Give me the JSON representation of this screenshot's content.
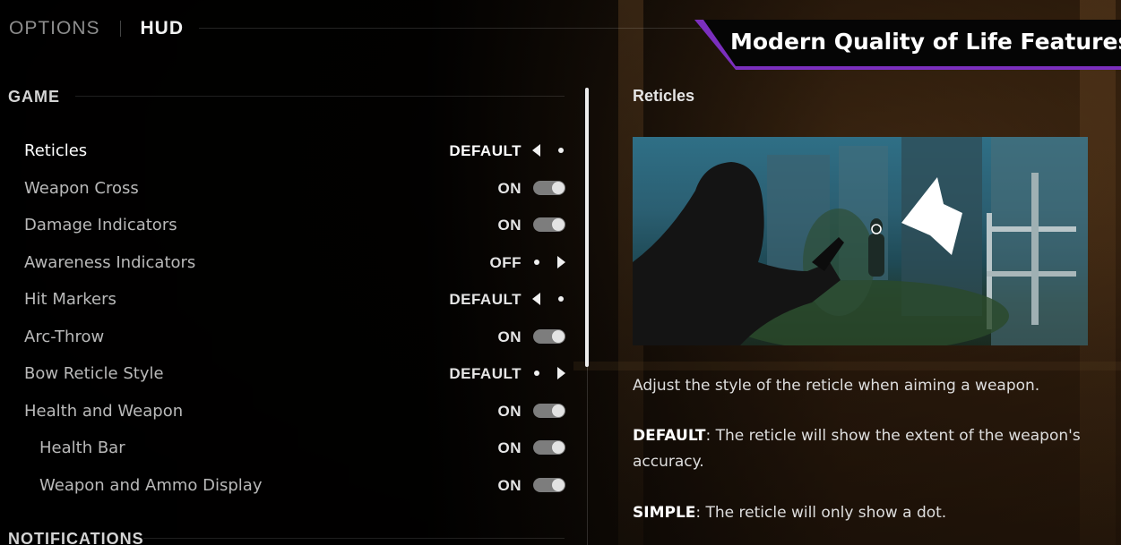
{
  "tabs": {
    "options": "OPTIONS",
    "hud": "HUD"
  },
  "banner": {
    "text": "Modern Quality of Life Features"
  },
  "sections": {
    "game": "GAME",
    "notifications": "NOTIFICATIONS"
  },
  "settings": [
    {
      "label": "Reticles",
      "value": "DEFAULT",
      "control": "option-left"
    },
    {
      "label": "Weapon Cross",
      "value": "ON",
      "control": "toggle"
    },
    {
      "label": "Damage Indicators",
      "value": "ON",
      "control": "toggle"
    },
    {
      "label": "Awareness Indicators",
      "value": "OFF",
      "control": "option-right"
    },
    {
      "label": "Hit Markers",
      "value": "DEFAULT",
      "control": "option-left"
    },
    {
      "label": "Arc-Throw",
      "value": "ON",
      "control": "toggle"
    },
    {
      "label": "Bow Reticle Style",
      "value": "DEFAULT",
      "control": "option-right"
    },
    {
      "label": "Health and Weapon",
      "value": "ON",
      "control": "toggle"
    },
    {
      "label": "Health Bar",
      "value": "ON",
      "control": "toggle"
    },
    {
      "label": "Weapon and Ammo Display",
      "value": "ON",
      "control": "toggle"
    }
  ],
  "selected_index": 0,
  "description": {
    "title": "Reticles",
    "intro": "Adjust the style of the reticle when aiming a weapon.",
    "default_key": "DEFAULT",
    "default_text": ": The reticle will show the extent of the weapon's accuracy.",
    "simple_key": "SIMPLE",
    "simple_text": ": The reticle will only show a dot."
  },
  "colors": {
    "banner_accent": "#7b2fbe",
    "toggle_track": "#7d7d7d",
    "toggle_knob": "#e3e3e3"
  },
  "icons": {
    "option_prev": "caret-left-icon",
    "option_next": "caret-right-icon",
    "option_dot": "dot-icon",
    "pointer": "arrow-pointer-icon"
  }
}
